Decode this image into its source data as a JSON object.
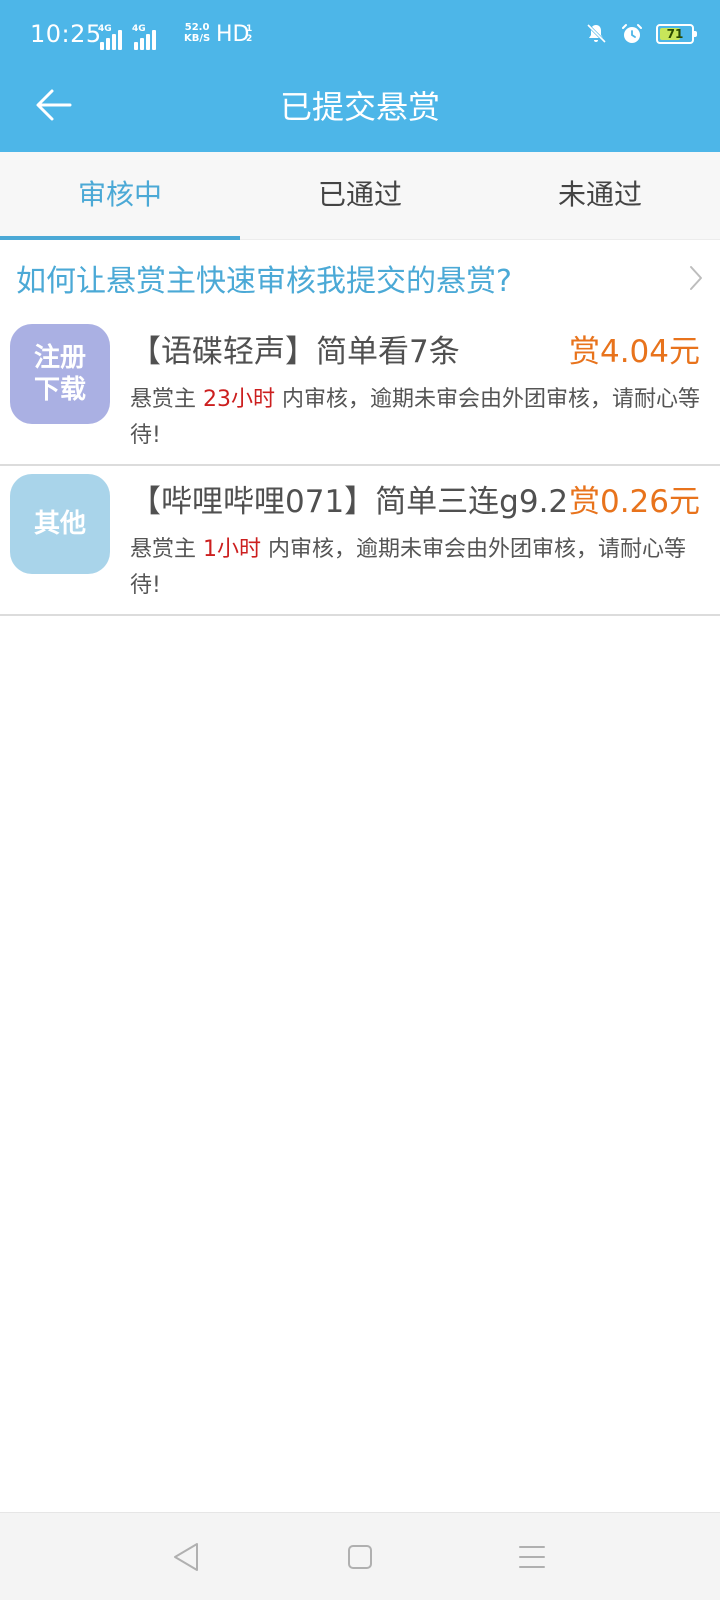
{
  "status": {
    "time": "10:25",
    "network_label_1": "4G",
    "network_label_2": "4G",
    "speed_value": "52.0",
    "speed_unit": "KB/S",
    "hd_label": "HD",
    "hd_sub": "1 2",
    "battery_level": "71",
    "battery_percent": 71
  },
  "header": {
    "title": "已提交悬赏",
    "back_icon": "arrow-left-icon"
  },
  "tabs": [
    {
      "label": "审核中",
      "active": true
    },
    {
      "label": "已通过",
      "active": false
    },
    {
      "label": "未通过",
      "active": false
    }
  ],
  "faq": {
    "text": "如何让悬赏主快速审核我提交的悬赏?"
  },
  "items": [
    {
      "icon_text_1": "注册",
      "icon_text_2": "下载",
      "icon_color": "#aab0e3",
      "title": "【语碟轻声】简单看7条",
      "reward": "赏4.04元",
      "desc_prefix": "悬赏主 ",
      "desc_time": "23小时",
      "desc_suffix": " 内审核，逾期未审会由外团审核，请耐心等待!"
    },
    {
      "icon_text_1": "其他",
      "icon_color": "#a9d4ea",
      "title": "【哔哩哔哩071】简单三连g9.2",
      "reward": "赏0.26元",
      "desc_prefix": "悬赏主 ",
      "desc_time": "1小时",
      "desc_suffix": " 内审核，逾期未审会由外团审核，请耐心等待!"
    }
  ],
  "colors": {
    "header": "#4db6e8",
    "accent": "#4ba9d6",
    "reward": "#e8731c",
    "highlight": "#cc1f1f"
  }
}
